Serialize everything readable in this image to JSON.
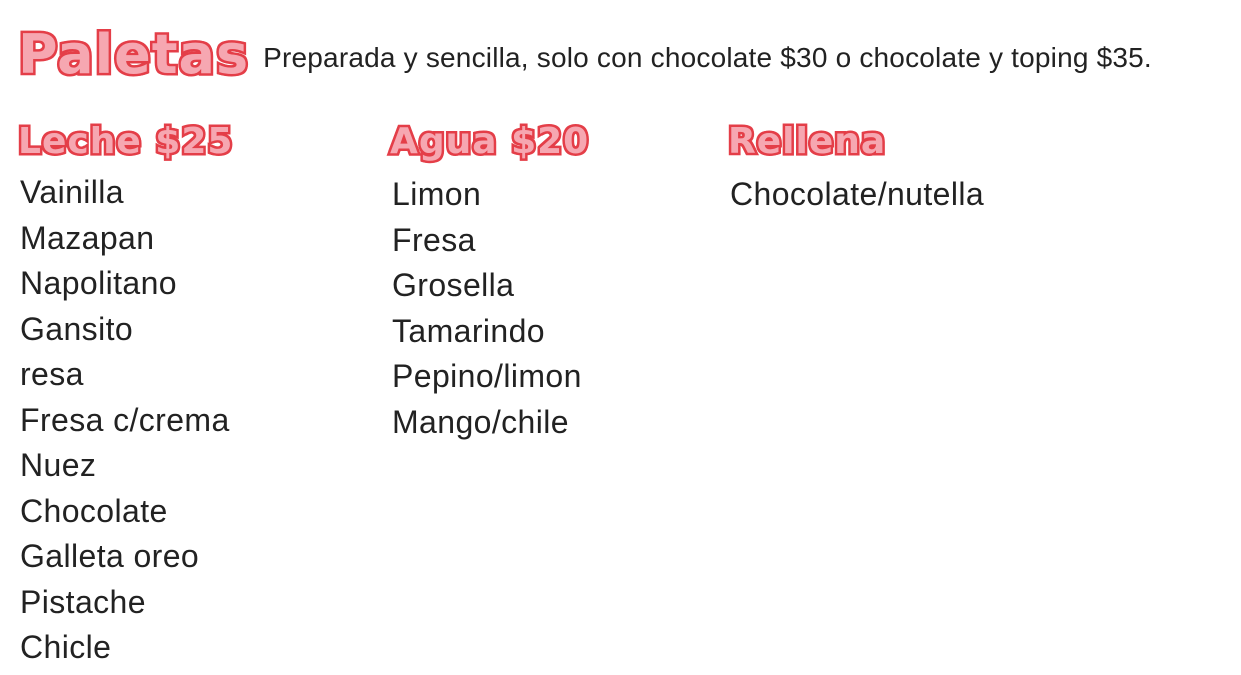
{
  "header": {
    "title": "Paletas",
    "subtitle": "Preparada y sencilla, solo con chocolate $30 o chocolate y toping $35."
  },
  "columns": [
    {
      "title": "Leche  $25",
      "items": [
        "Vainilla",
        "Mazapan",
        "Napolitano",
        "Gansito",
        "resa",
        "Fresa c/crema",
        "Nuez",
        "Chocolate",
        "Galleta oreo",
        "Pistache",
        "Chicle"
      ]
    },
    {
      "title": "Agua  $20",
      "items": [
        "Limon",
        "Fresa",
        "Grosella",
        "Tamarindo",
        "Pepino/limon",
        "Mango/chile"
      ]
    },
    {
      "title": "Rellena",
      "items": [
        "Chocolate/nutella"
      ]
    }
  ],
  "colors": {
    "heading_fill": "#f6a7b1",
    "heading_outline": "#e43e48",
    "text": "#222222",
    "background": "#ffffff"
  }
}
